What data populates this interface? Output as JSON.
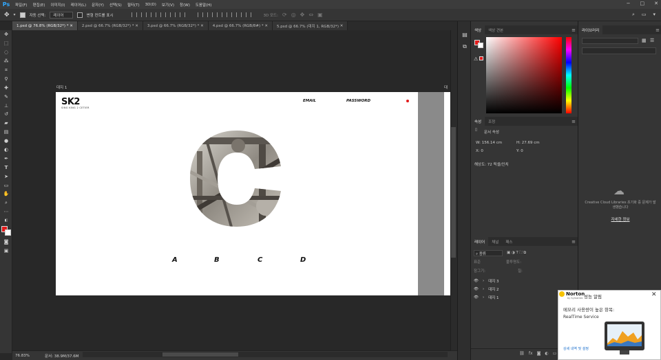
{
  "app": {
    "logo": "Ps"
  },
  "menu": [
    "파일(F)",
    "편집(E)",
    "이미지(I)",
    "레이어(L)",
    "문자(Y)",
    "선택(S)",
    "필터(T)",
    "3D(D)",
    "보기(V)",
    "창(W)",
    "도움말(H)"
  ],
  "window_controls": [
    "−",
    "□",
    "✕"
  ],
  "options": {
    "auto_select_label": "자동 선택:",
    "auto_select_value": "레이어",
    "show_transform_label": "변형 컨트롤 표시",
    "three_d_mode": "3D 모드:"
  },
  "tabs": [
    {
      "label": "1.psd @ 76.8% (RGB/32*) *",
      "active": true
    },
    {
      "label": "2.psd @ 66.7% (RGB/32*) *",
      "active": false
    },
    {
      "label": "3.psd @ 66.7% (RGB/32*) *",
      "active": false
    },
    {
      "label": "4.psd @ 66.7% (RGB/8#) *",
      "active": false
    },
    {
      "label": "5.psd @ 66.7% (대지 1, RGB/32*)",
      "active": false
    }
  ],
  "canvas": {
    "artboard_label": "대지 1",
    "artboard_label_2": "대",
    "logo": "SK2",
    "logo_sub": "SING KING 2 CETIER",
    "nav_email": "EMAIL",
    "nav_password": "PASSWORD",
    "letters": [
      "A",
      "B",
      "C",
      "D"
    ],
    "accent_color": "#e21b1b"
  },
  "status": {
    "zoom": "76.83%",
    "doc": "문서: 38.9M/37.6M"
  },
  "color_panel": {
    "tabs": [
      "색상",
      "색상 견본"
    ],
    "foreground": "#e21b1b",
    "background": "#ffffff"
  },
  "properties_panel": {
    "tabs": [
      "속성",
      "조정"
    ],
    "type_label": "문서 속성",
    "w": "W:  156.14 cm",
    "h": "H:  27.69 cm",
    "x": "X:  0",
    "y": "Y:  0",
    "resolution": "해상도: 72 픽셀/인치"
  },
  "layers_panel": {
    "tabs": [
      "레이어",
      "채널",
      "패스"
    ],
    "filter": "종류",
    "blend_mode": "표준",
    "opacity_label": "불투명도:",
    "lock_label": "잠그기:",
    "fill_label": "칠:",
    "layers": [
      "대지 3",
      "대지 2",
      "대지 1"
    ]
  },
  "libraries_panel": {
    "tab": "라이브러리",
    "search_placeholder": "",
    "message": "Creative Cloud Libraries 초기화 중 문제가 발생했습니다",
    "link": "자세한 정보"
  },
  "norton": {
    "brand": "Norton",
    "brand_sub": "by Symantec",
    "title": "성능 알림",
    "message": "메모리 사용량이 높은 항목:",
    "service": "RealTime Service",
    "detail_link": "상세 내역 및 설정",
    "close": "✕"
  }
}
